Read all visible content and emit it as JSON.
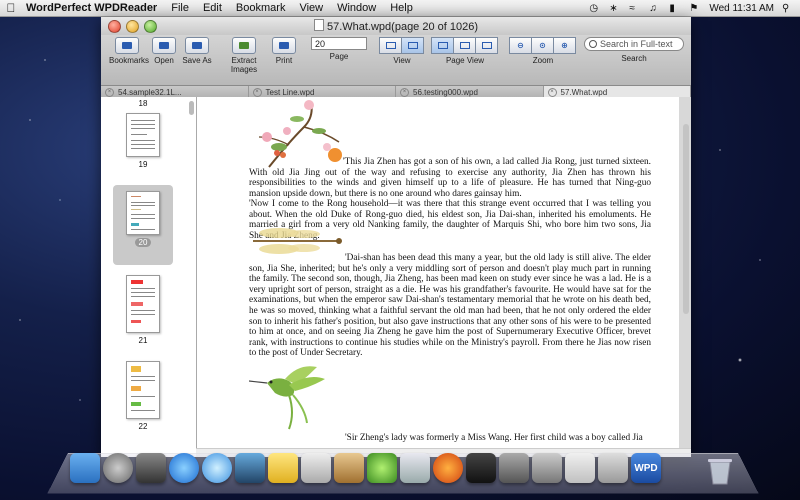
{
  "menubar": {
    "app_name": "WordPerfect WPDReader",
    "items": [
      "File",
      "Edit",
      "Bookmark",
      "View",
      "Window",
      "Help"
    ],
    "clock": "Wed 11:31 AM"
  },
  "window": {
    "title": "57.What.wpd(page 20 of 1026)"
  },
  "toolbar": {
    "bookmarks": "Bookmarks",
    "open": "Open",
    "save_as": "Save As",
    "extract_images": "Extract Images",
    "print": "Print",
    "page_value": "20",
    "page_label": "Page",
    "view_label": "View",
    "page_view_label": "Page View",
    "zoom_label": "Zoom",
    "search_placeholder": "Search in Full-text",
    "search_label": "Search"
  },
  "tabs": [
    {
      "label": "54.sample32.1L..."
    },
    {
      "label": "Test Line.wpd"
    },
    {
      "label": "56.testing000.wpd"
    },
    {
      "label": "57.What.wpd"
    }
  ],
  "thumbnails": [
    "18",
    "19",
    "20",
    "21",
    "22"
  ],
  "document": {
    "p1": "'This Jia Zhen has got a son of his own, a lad called Jia Rong, just turned sixteen. With old Jia Jing out of the way and refusing to exercise any authority, Jia Zhen has thrown his responsibilities to the winds and given himself up to a life of pleasure. He has turned that Ning-guo mansion upside down, but there is no one around who dares gainsay him.",
    "p2": "'Now I come to the Rong household—it was there that this strange event occurred that I was telling you about. When the old Duke of Rong-guo died, his eldest son, Jia Dai-shan, inherited his emoluments. He married a girl from a very old Nanking family, the daughter of Marquis Shi, who bore him two sons, Jia She and Jia Zheng.",
    "p3": "'Dai-shan has been dead this many a year, but the old lady is still alive. The elder son, Jia She, inherited; but he's only a very middling sort of person and doesn't play much part in running the family. The second son, though, Jia Zheng, has been mad keen on study ever since he was a lad. He is a very upright sort of person, straight as a die. He was his grandfather's favourite. He would have sat for the examinations, but when the emperor saw Dai-shan's testamentary memorial that he wrote on his death bed, he was so moved, thinking what a faithful servant the old man had been, that he not only ordered the elder son to inherit his father's position, but also gave instructions that any other sons of his were to be presented to him at once, and on seeing Jia Zheng he gave him the post of Supernumerary Executive Officer, brevet rank, with instructions to continue his studies while on the Ministry's payroll. From there he Jias now risen to the post of Under Secretary.",
    "p4": "'Sir Zheng's lady was formerly a Miss Wang. Her first child was a boy called Jia"
  },
  "dock": {
    "app_label": "WPD"
  }
}
